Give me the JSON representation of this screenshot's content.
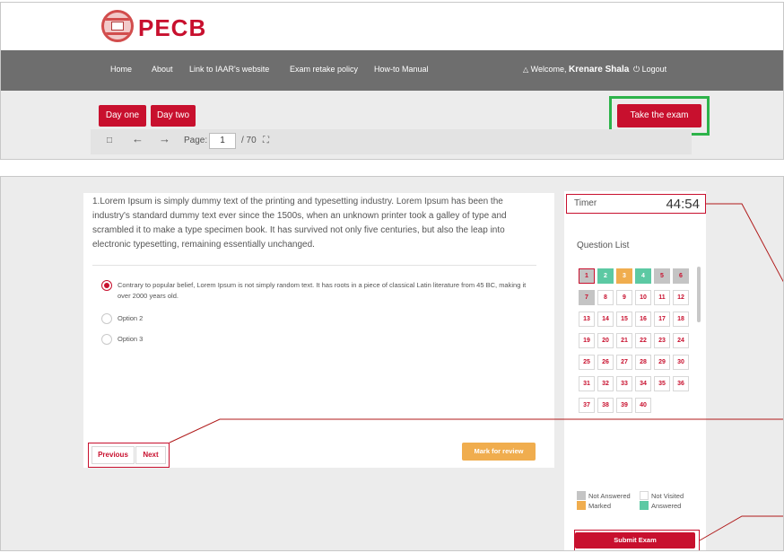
{
  "brand": {
    "name": "PECB"
  },
  "nav": {
    "items": [
      "Home",
      "About",
      "Link to IAAR's website",
      "Exam retake policy",
      "How-to Manual"
    ],
    "welcome_prefix": "Welcome,",
    "user_name": "Krenare Shala",
    "logout": "Logout"
  },
  "buttons": {
    "day_one": "Day one",
    "day_two": "Day two",
    "take_exam": "Take the exam"
  },
  "viewer": {
    "page_label": "Page:",
    "current_page": "1",
    "total_pages": "/ 70"
  },
  "question": {
    "text": "1.Lorem Ipsum is simply dummy text of the printing and typesetting industry. Lorem Ipsum has been the industry's standard dummy text ever since the 1500s, when an unknown printer took a galley of type and scrambled it to make a type specimen book. It has survived not only five centuries, but also the leap into electronic typesetting, remaining essentially unchanged.",
    "options": [
      "Contrary to popular belief, Lorem Ipsum is not simply random text. It has roots in a piece of classical Latin literature from 45 BC, making it over 2000 years old.",
      "Option 2",
      "Option 3"
    ],
    "selected_option": 1
  },
  "controls": {
    "previous": "Previous",
    "next": "Next",
    "mark_for_review": "Mark for review"
  },
  "panel": {
    "timer_label": "Timer",
    "timer_value": "44:54",
    "question_list_label": "Question List",
    "questions": [
      {
        "n": "1",
        "status": "current"
      },
      {
        "n": "2",
        "status": "answered"
      },
      {
        "n": "3",
        "status": "marked"
      },
      {
        "n": "4",
        "status": "answered"
      },
      {
        "n": "5",
        "status": "not-answered"
      },
      {
        "n": "6",
        "status": "not-answered"
      },
      {
        "n": "7",
        "status": "not-answered"
      },
      {
        "n": "8",
        "status": "not-visited"
      },
      {
        "n": "9",
        "status": "not-visited"
      },
      {
        "n": "10",
        "status": "not-visited"
      },
      {
        "n": "11",
        "status": "not-visited"
      },
      {
        "n": "12",
        "status": "not-visited"
      },
      {
        "n": "13",
        "status": "not-visited"
      },
      {
        "n": "14",
        "status": "not-visited"
      },
      {
        "n": "15",
        "status": "not-visited"
      },
      {
        "n": "16",
        "status": "not-visited"
      },
      {
        "n": "17",
        "status": "not-visited"
      },
      {
        "n": "18",
        "status": "not-visited"
      },
      {
        "n": "19",
        "status": "not-visited"
      },
      {
        "n": "20",
        "status": "not-visited"
      },
      {
        "n": "21",
        "status": "not-visited"
      },
      {
        "n": "22",
        "status": "not-visited"
      },
      {
        "n": "23",
        "status": "not-visited"
      },
      {
        "n": "24",
        "status": "not-visited"
      },
      {
        "n": "25",
        "status": "not-visited"
      },
      {
        "n": "26",
        "status": "not-visited"
      },
      {
        "n": "27",
        "status": "not-visited"
      },
      {
        "n": "28",
        "status": "not-visited"
      },
      {
        "n": "29",
        "status": "not-visited"
      },
      {
        "n": "30",
        "status": "not-visited"
      },
      {
        "n": "31",
        "status": "not-visited"
      },
      {
        "n": "32",
        "status": "not-visited"
      },
      {
        "n": "33",
        "status": "not-visited"
      },
      {
        "n": "34",
        "status": "not-visited"
      },
      {
        "n": "35",
        "status": "not-visited"
      },
      {
        "n": "36",
        "status": "not-visited"
      },
      {
        "n": "37",
        "status": "not-visited"
      },
      {
        "n": "38",
        "status": "not-visited"
      },
      {
        "n": "39",
        "status": "not-visited"
      },
      {
        "n": "40",
        "status": "not-visited"
      }
    ],
    "legend": {
      "not_answered": "Not Answered",
      "not_visited": "Not Visited",
      "marked": "Marked",
      "answered": "Answered"
    },
    "submit": "Submit Exam"
  },
  "colors": {
    "brand_red": "#c8102e",
    "nav_gray": "#6e6e6e",
    "answered": "#5cc9a3",
    "marked": "#f0ad4e",
    "not_answered": "#c4c4c4",
    "highlight_green": "#2db34a"
  },
  "icons": [
    "user-icon",
    "power-icon",
    "sidebar-toggle-icon",
    "arrow-left-icon",
    "arrow-right-icon",
    "fullscreen-icon"
  ]
}
